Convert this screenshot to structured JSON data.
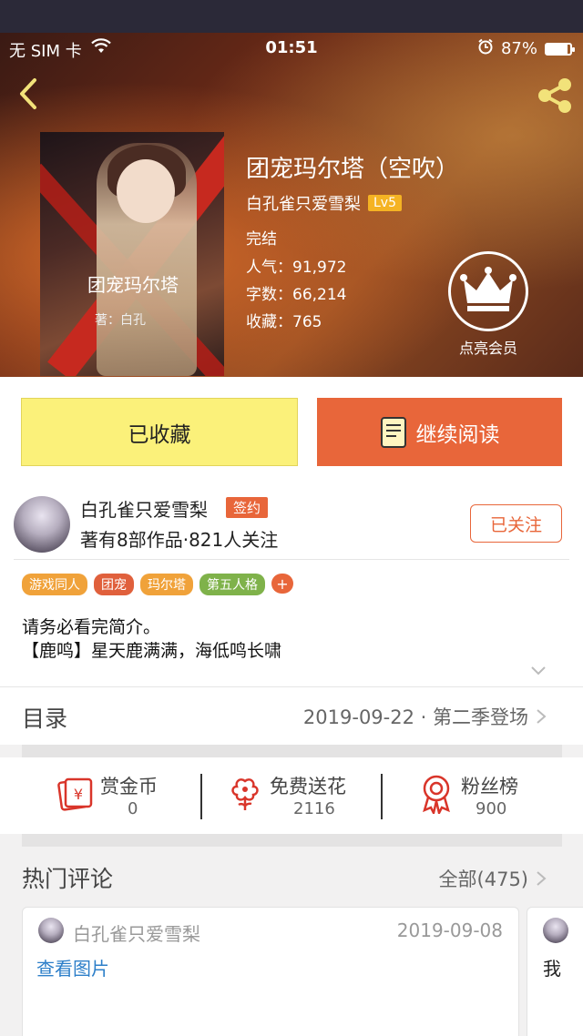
{
  "status_bar": {
    "carrier": "无 SIM 卡",
    "time": "01:51",
    "battery": "87%",
    "battery_level": 0.87,
    "icons": [
      "wifi-icon",
      "alarm-icon",
      "battery-icon"
    ]
  },
  "nav": {
    "back_icon": "chevron-left-icon",
    "share_icon": "share-icon"
  },
  "book": {
    "cover_title": "团宠玛尔塔",
    "cover_author": "著：白孔",
    "title": "团宠玛尔塔（空吹）",
    "author": "白孔雀只爱雪梨",
    "level": "Lv5",
    "status": "完结",
    "popularity": "人气：91,972",
    "word_count": "字数：66,214",
    "favorites": "收藏：765"
  },
  "vip": {
    "icon": "crown-icon",
    "label": "点亮会员"
  },
  "actions": {
    "favorite_label": "已收藏",
    "read_label": "继续阅读",
    "read_icon": "book-icon"
  },
  "author_card": {
    "name": "白孔雀只爱雪梨",
    "badge": "签约",
    "summary": "著有8部作品·821人关注",
    "follow_label": "已关注"
  },
  "tags": [
    {
      "label": "游戏同人",
      "color": "#f0a23a"
    },
    {
      "label": "团宠",
      "color": "#e0603c"
    },
    {
      "label": "玛尔塔",
      "color": "#f0a23a"
    },
    {
      "label": "第五人格",
      "color": "#7fb24a"
    }
  ],
  "tag_add": "+",
  "description": {
    "line1": "请务必看完简介。",
    "line2": "【鹿鸣】星天鹿满满，海低鸣长啸"
  },
  "catalog": {
    "label": "目录",
    "update": "2019-09-22 · 第二季登场"
  },
  "rewards": [
    {
      "label": "赏金币",
      "value": "0",
      "icon": "red-envelope-icon"
    },
    {
      "label": "免费送花",
      "value": "2116",
      "icon": "flower-icon"
    },
    {
      "label": "粉丝榜",
      "value": "900",
      "icon": "medal-icon"
    }
  ],
  "comments": {
    "label": "热门评论",
    "all": "全部(475)",
    "items": [
      {
        "name": "白孔雀只爱雪梨",
        "date": "2019-09-08",
        "text": "查看图片"
      },
      {
        "text": "我"
      }
    ]
  },
  "colors": {
    "accent": "#e8663a",
    "favorite_bg": "#fbf17a",
    "link": "#2d7fc9"
  }
}
